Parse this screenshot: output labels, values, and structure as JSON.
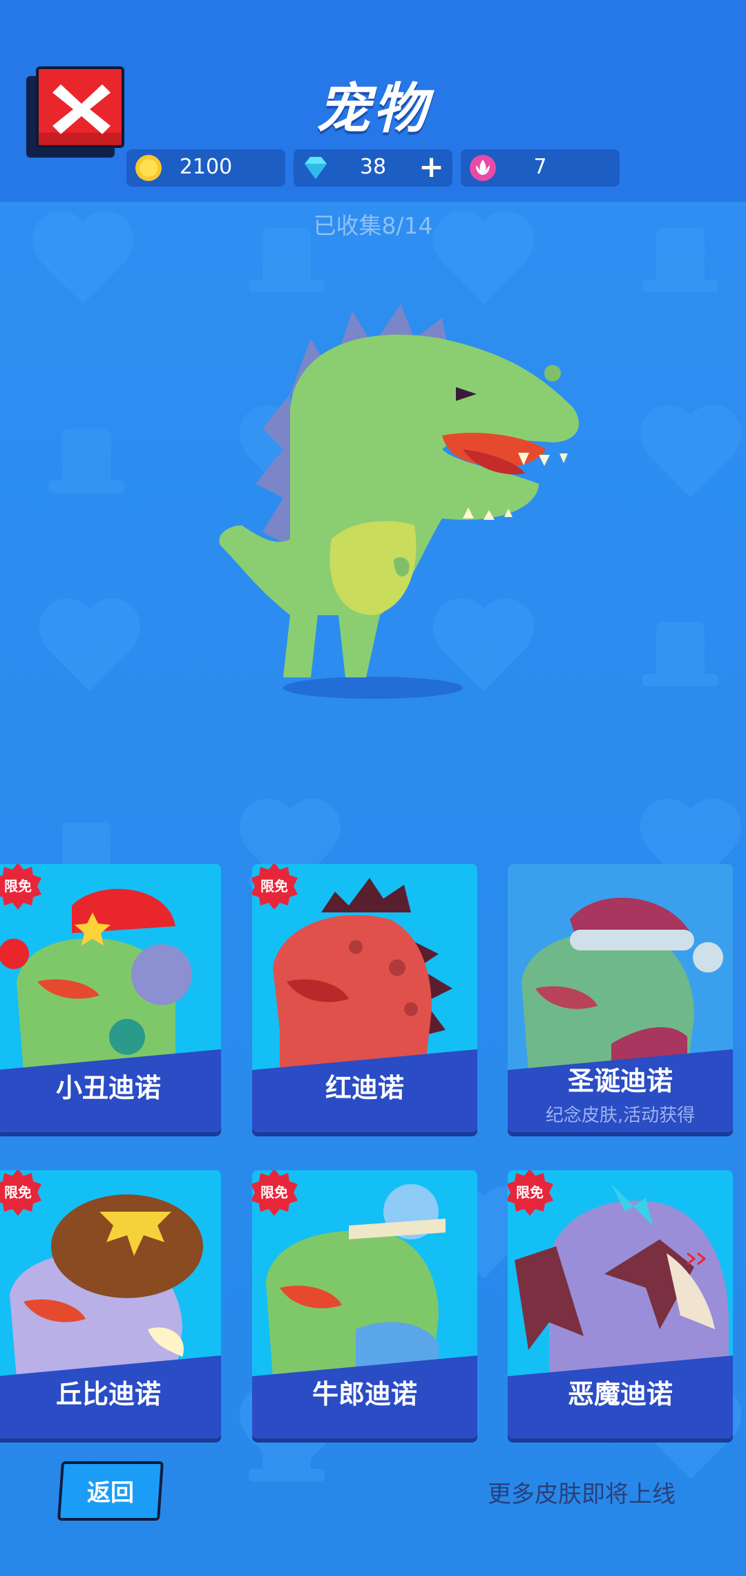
{
  "header": {
    "title": "宠物",
    "close_icon": "close-x-icon"
  },
  "currencies": {
    "coins": {
      "icon": "coin-icon",
      "value": "2100"
    },
    "diamonds": {
      "icon": "diamond-icon",
      "value": "38",
      "add_label": "+"
    },
    "tokens": {
      "icon": "lotus-token-icon",
      "value": "7"
    }
  },
  "collection": {
    "status": "已收集8/14"
  },
  "preview": {
    "pet_icon": "green-dino-pet"
  },
  "skins": [
    {
      "name": "小丑迪诺",
      "badge": "限免",
      "subtitle": "",
      "locked": false
    },
    {
      "name": "红迪诺",
      "badge": "限免",
      "subtitle": "",
      "locked": false
    },
    {
      "name": "圣诞迪诺",
      "badge": "",
      "subtitle": "纪念皮肤,活动获得",
      "locked": true
    },
    {
      "name": "丘比迪诺",
      "badge": "限免",
      "subtitle": "",
      "locked": false
    },
    {
      "name": "牛郎迪诺",
      "badge": "限免",
      "subtitle": "",
      "locked": false
    },
    {
      "name": "恶魔迪诺",
      "badge": "限免",
      "subtitle": "",
      "locked": false
    }
  ],
  "footer": {
    "back_label": "返回",
    "more_skins_text": "更多皮肤即将上线"
  },
  "colors": {
    "background": "#2a8cf0",
    "header": "#2677e8",
    "card": "#14bff5",
    "banner": "#2a4cc4",
    "badge": "#e8263a",
    "close": "#e8262c"
  }
}
